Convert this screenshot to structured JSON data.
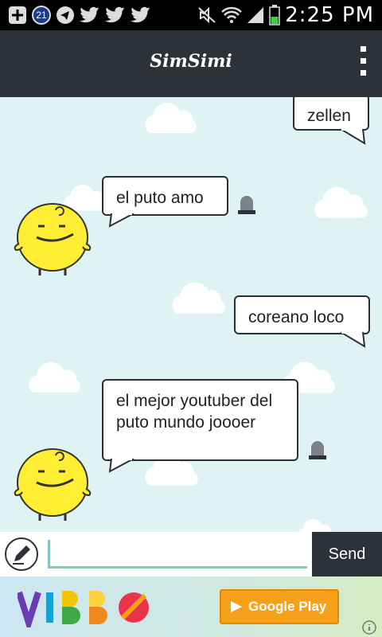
{
  "status_bar": {
    "time": "2:25 PM",
    "notification_badge": "21"
  },
  "app_bar": {
    "title": "SimSimi"
  },
  "messages": [
    {
      "from": "user",
      "text": "zellen"
    },
    {
      "from": "bot",
      "text": "el puto amo"
    },
    {
      "from": "user",
      "text": "coreano loco"
    },
    {
      "from": "bot",
      "text": "el mejor youtuber del puto mundo joooer"
    }
  ],
  "composer": {
    "value": "",
    "placeholder": "",
    "send_label": "Send"
  },
  "ad": {
    "brand": "VIBBO",
    "store_label": "Google Play"
  },
  "colors": {
    "accent": "#7ec8c1",
    "bar": "#2d3238",
    "chat_bg": "#dff3f5",
    "bot_yellow": "#ffee33"
  }
}
